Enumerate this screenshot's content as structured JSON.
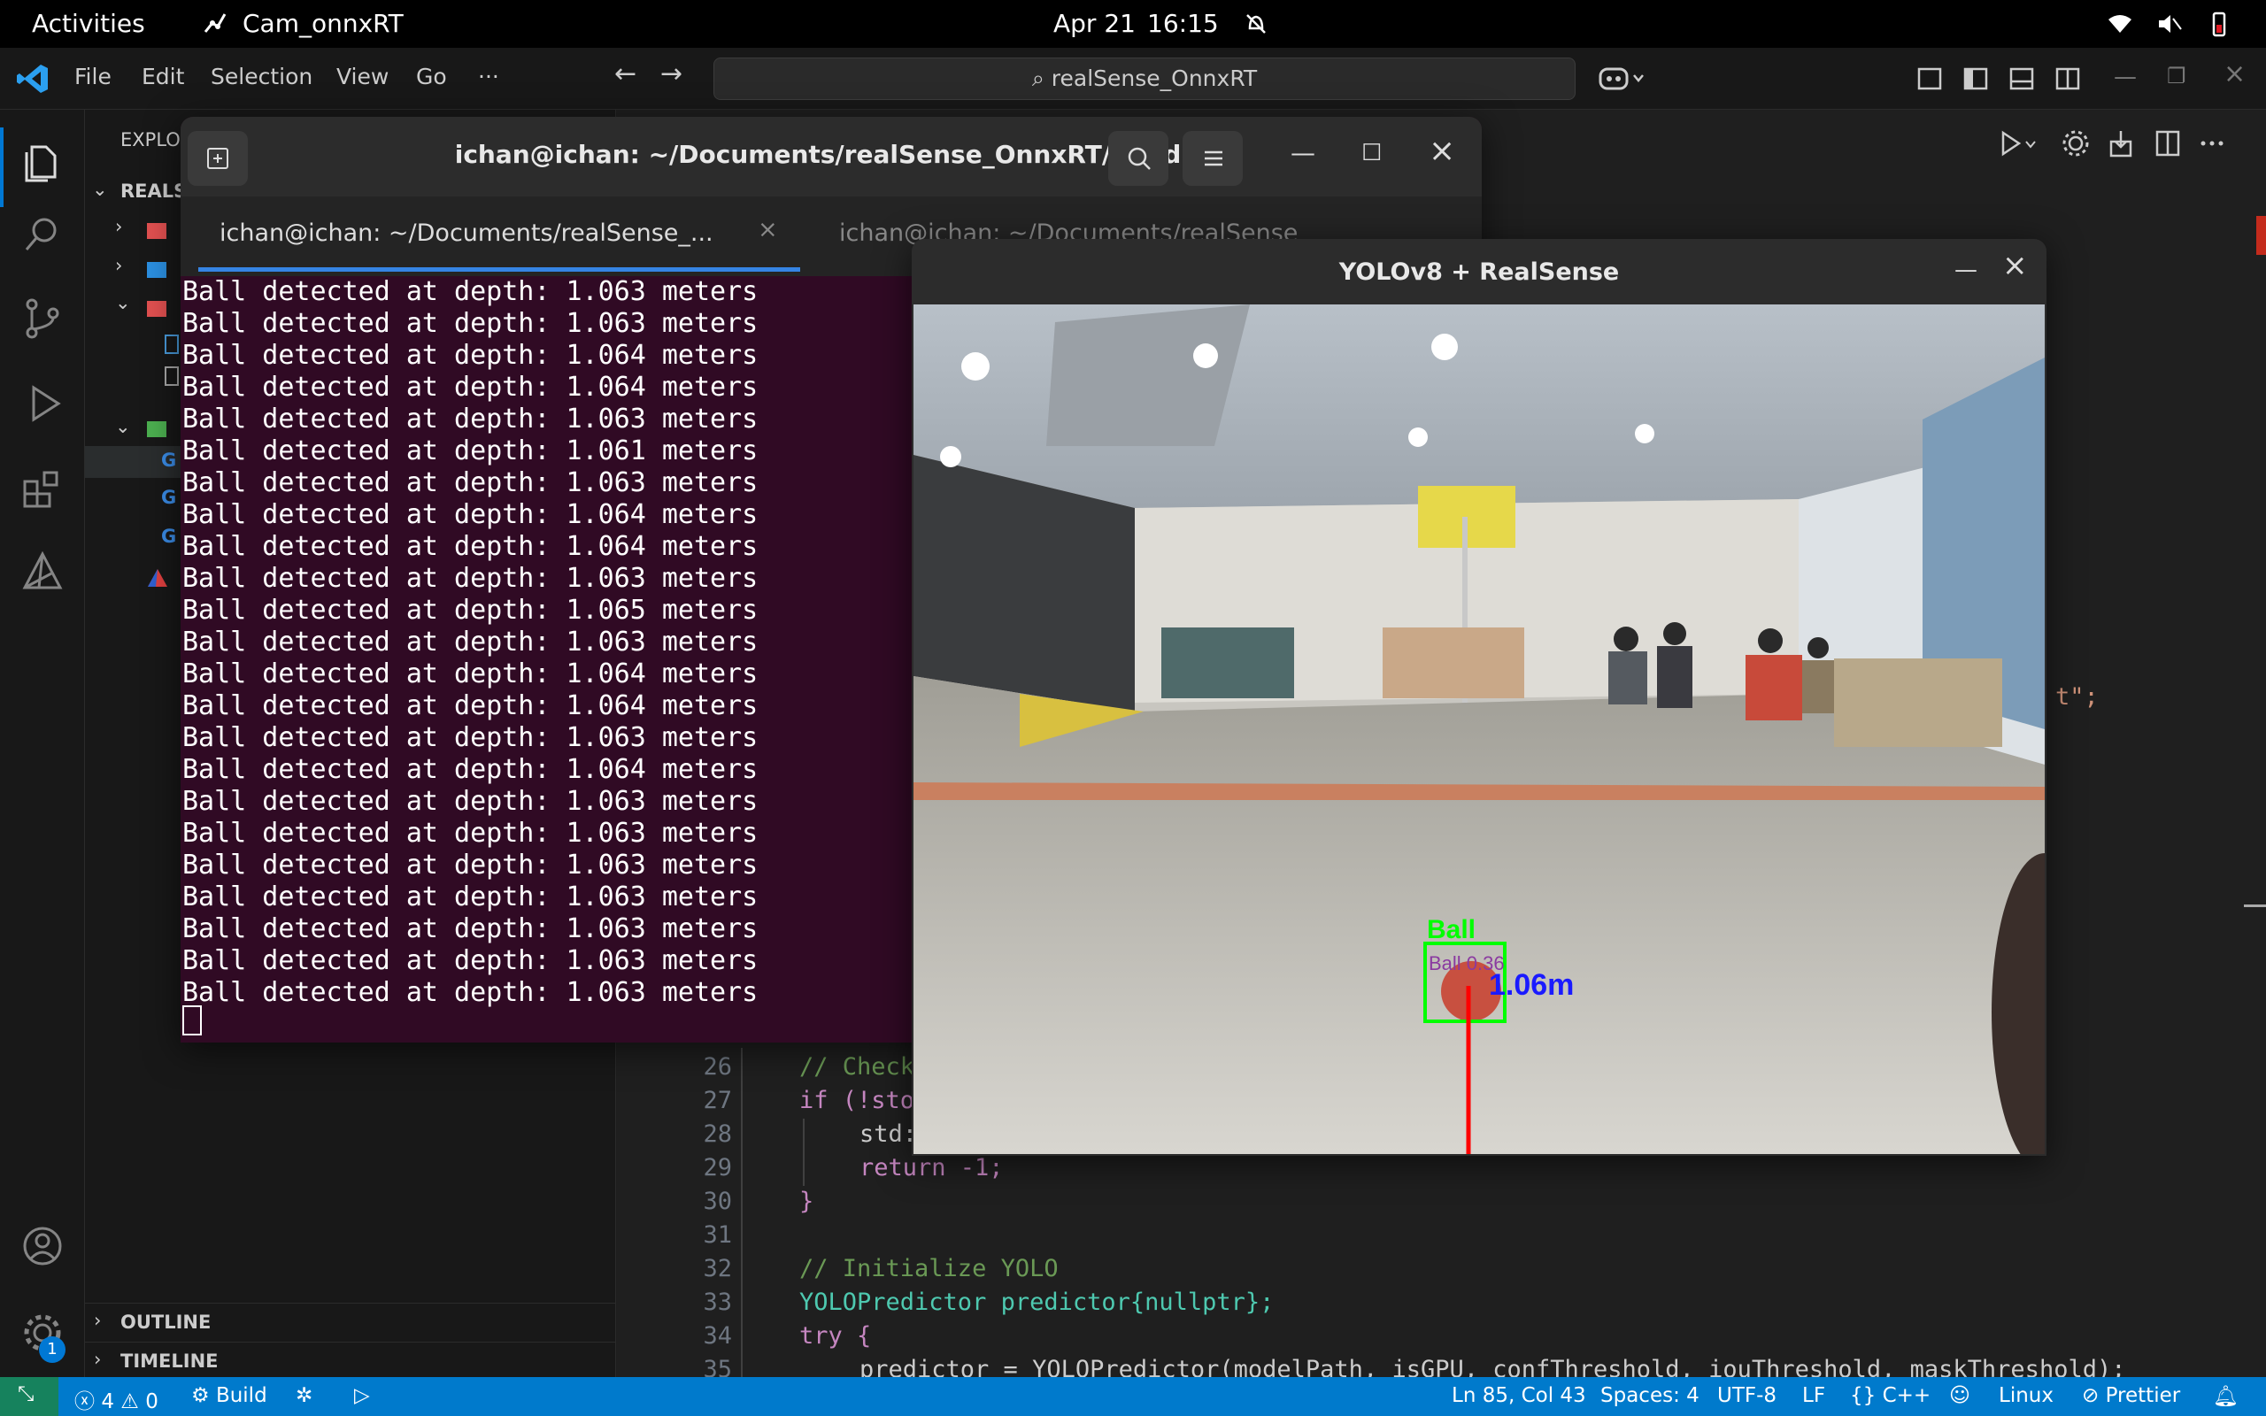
{
  "topbar": {
    "activities": "Activities",
    "app_name": "Cam_onnxRT",
    "date": "Apr 21",
    "time": "16:15"
  },
  "vscode": {
    "menu": [
      "File",
      "Edit",
      "Selection",
      "View",
      "Go",
      "···"
    ],
    "search_text": "realSense_OnnxRT",
    "explorer_label": "EXPLO",
    "project_label": "REALS",
    "outline_label": "OUTLINE",
    "timeline_label": "TIMELINE",
    "accounts_badge": "1",
    "code_overflow_fragment": "t\";",
    "lines": [
      {
        "num": "26",
        "text": "// Check"
      },
      {
        "num": "27",
        "text": "if (!sto"
      },
      {
        "num": "28",
        "text": "std:"
      },
      {
        "num": "29",
        "text": "return -1;"
      },
      {
        "num": "30",
        "text": "}"
      },
      {
        "num": "31",
        "text": ""
      },
      {
        "num": "32",
        "text": "// Initialize YOLO"
      },
      {
        "num": "33",
        "text": "YOLOPredictor predictor{nullptr};"
      },
      {
        "num": "34",
        "text": "try {"
      },
      {
        "num": "35",
        "text": "predictor = YOLOPredictor(modelPath, isGPU, confThreshold, iouThreshold, maskThreshold);"
      }
    ]
  },
  "status": {
    "errors": "4",
    "warnings": "0",
    "build": "Build",
    "position": "Ln 85, Col 43",
    "spaces": "Spaces: 4",
    "encoding": "UTF-8",
    "eol": "LF",
    "language": "C++",
    "platform": "Linux",
    "formatter": "Prettier"
  },
  "terminal": {
    "title": "ichan@ichan: ~/Documents/realSense_OnnxRT/build",
    "tab1": "ichan@ichan: ~/Documents/realSense_...",
    "tab2": "ichan@ichan: ~/Documents/realSense",
    "output": [
      "Ball detected at depth: 1.063 meters",
      "Ball detected at depth: 1.063 meters",
      "Ball detected at depth: 1.064 meters",
      "Ball detected at depth: 1.064 meters",
      "Ball detected at depth: 1.063 meters",
      "Ball detected at depth: 1.061 meters",
      "Ball detected at depth: 1.063 meters",
      "Ball detected at depth: 1.064 meters",
      "Ball detected at depth: 1.064 meters",
      "Ball detected at depth: 1.063 meters",
      "Ball detected at depth: 1.065 meters",
      "Ball detected at depth: 1.063 meters",
      "Ball detected at depth: 1.064 meters",
      "Ball detected at depth: 1.064 meters",
      "Ball detected at depth: 1.063 meters",
      "Ball detected at depth: 1.064 meters",
      "Ball detected at depth: 1.063 meters",
      "Ball detected at depth: 1.063 meters",
      "Ball detected at depth: 1.063 meters",
      "Ball detected at depth: 1.063 meters",
      "Ball detected at depth: 1.063 meters",
      "Ball detected at depth: 1.063 meters",
      "Ball detected at depth: 1.063 meters"
    ]
  },
  "yolo": {
    "title": "YOLOv8 + RealSense",
    "class_label": "Ball",
    "score_label": "Ball 0.36",
    "depth_label": "1.06m"
  },
  "colors": {
    "terminal_bg": "#300a24",
    "status_bar": "#007acc",
    "detection_box": "#00ff00",
    "depth_text": "#1a1aff",
    "depth_line": "#ff0000"
  }
}
